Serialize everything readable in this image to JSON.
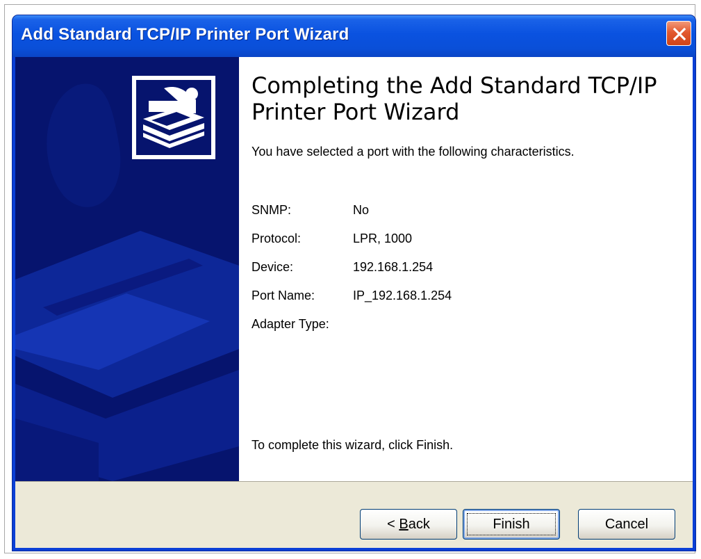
{
  "window": {
    "title": "Add Standard TCP/IP Printer Port Wizard",
    "title_bar_color": "#0a52e0",
    "close_icon": "close-icon"
  },
  "header": {
    "title": "Completing the Add Standard TCP/IP Printer Port Wizard",
    "icon": "printer-icon"
  },
  "main": {
    "intro": "You have selected a port with the following characteristics.",
    "details": [
      {
        "label": "SNMP:",
        "value": "No"
      },
      {
        "label": "Protocol:",
        "value": "LPR, 1000"
      },
      {
        "label": "Device:",
        "value": "192.168.1.254"
      },
      {
        "label": "Port Name:",
        "value": "IP_192.168.1.254"
      },
      {
        "label": "Adapter Type:",
        "value": ""
      }
    ],
    "finish_hint": "To complete this wizard, click Finish."
  },
  "buttons": {
    "back_prefix": "< ",
    "back_accel": "B",
    "back_rest": "ack",
    "finish": "Finish",
    "cancel": "Cancel"
  },
  "colors": {
    "side_panel": "#06146e",
    "dialog_bar": "#ece9d8",
    "content_bg": "#ffffff"
  }
}
